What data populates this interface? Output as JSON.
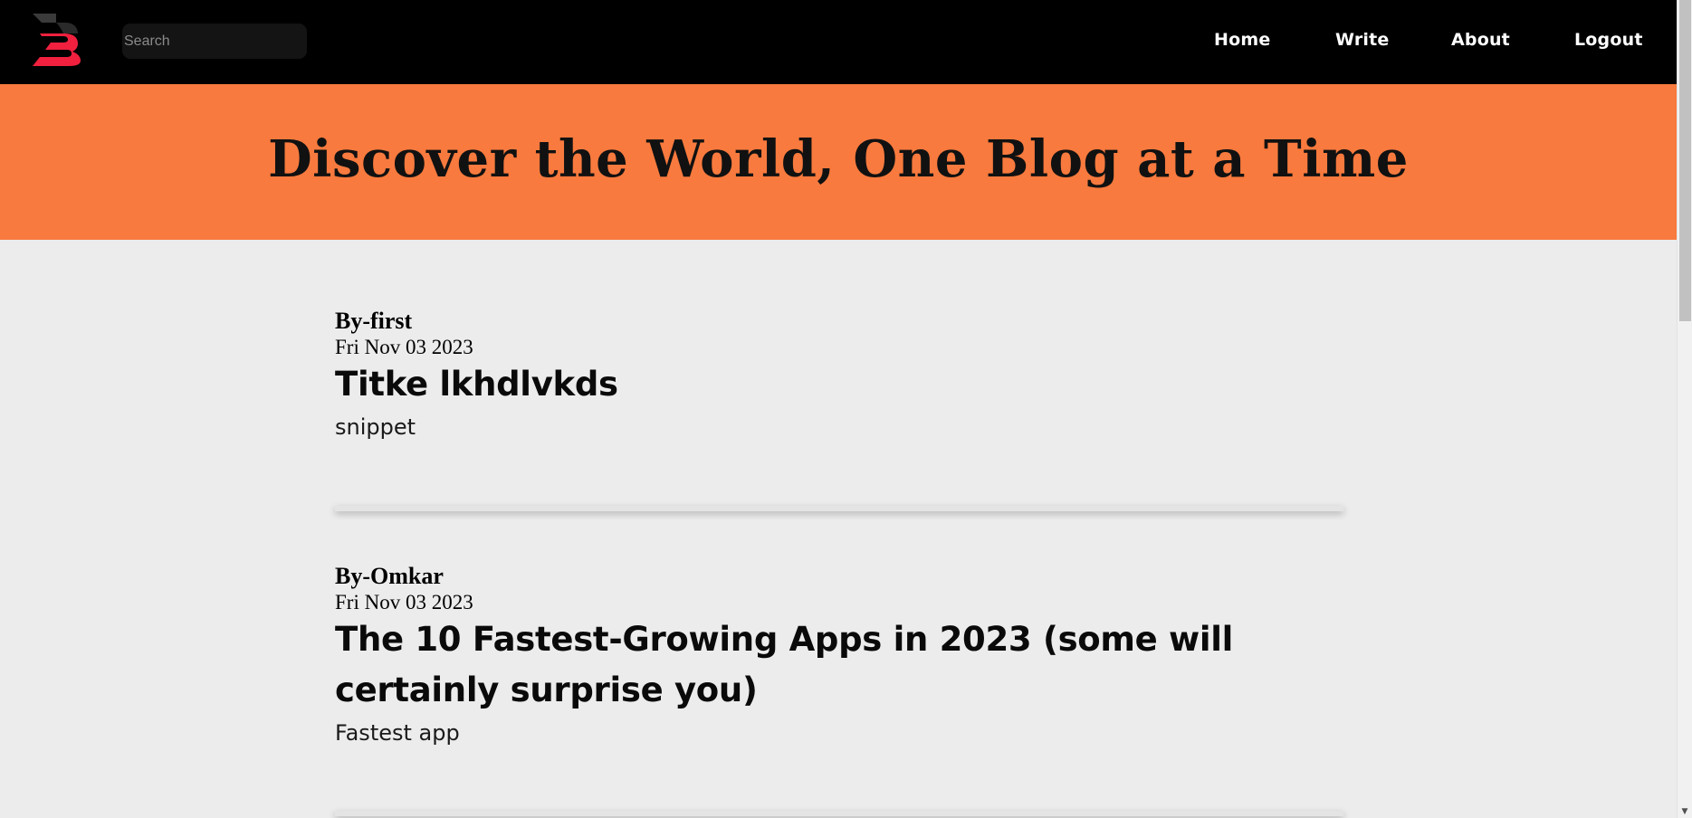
{
  "header": {
    "logo_icon": "b-logo-icon",
    "search": {
      "placeholder": "Search",
      "value": ""
    },
    "nav": [
      {
        "label": "Home"
      },
      {
        "label": "Write"
      },
      {
        "label": "About"
      },
      {
        "label": "Logout"
      }
    ]
  },
  "hero": {
    "title": "Discover the World, One Blog at a Time"
  },
  "posts": [
    {
      "author": "By-first",
      "date": "Fri Nov 03 2023",
      "title": "Titke lkhdlvkds",
      "snippet": "snippet"
    },
    {
      "author": "By-Omkar",
      "date": "Fri Nov 03 2023",
      "title": "The 10 Fastest-Growing Apps in 2023 (some will certainly surprise you)",
      "snippet": "Fastest app"
    }
  ],
  "colors": {
    "header_bg": "#000000",
    "hero_bg": "#f87a3e",
    "page_bg": "#ececec",
    "logo_accent": "#f0203e"
  }
}
